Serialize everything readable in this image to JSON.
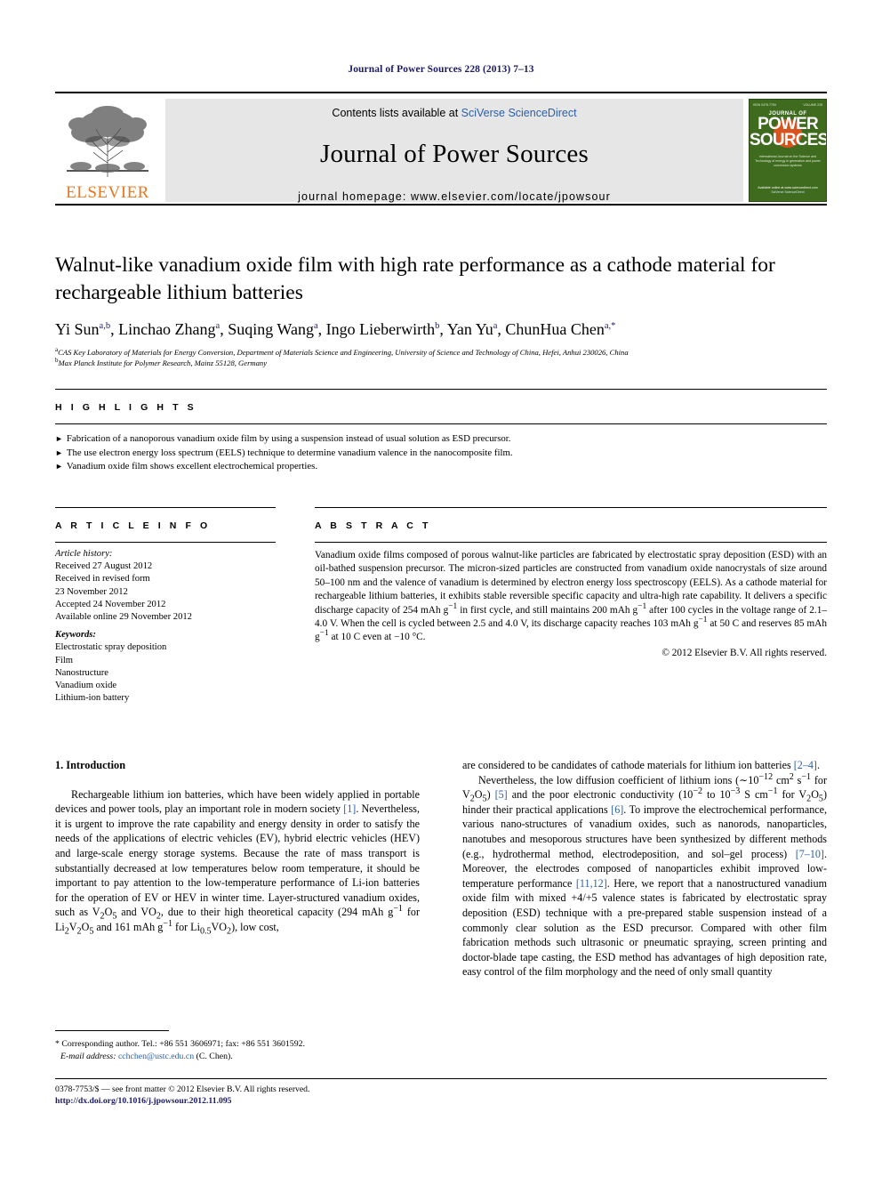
{
  "running_head": "Journal of Power Sources 228 (2013) 7–13",
  "masthead": {
    "contents_prefix": "Contents lists available at ",
    "contents_link": "SciVerse ScienceDirect",
    "journal_title": "Journal of Power Sources",
    "homepage": "journal homepage: www.elsevier.com/locate/jpowsour",
    "publisher": "ELSEVIER",
    "cover": {
      "journal_of": "JOURNAL OF",
      "power": "POWER",
      "sources": "SOURCES",
      "subtitle": "International Journal on the Science and Technology of energy in generation and power conversion systems",
      "bottom_line1": "Available online at www.sciencedirect.com",
      "bottom_line2": "SciVerse ScienceDirect",
      "corner_left": "ISSN 0378-7753",
      "corner_right": "VOLUME 228"
    }
  },
  "article": {
    "title": "Walnut-like vanadium oxide film with high rate performance as a cathode material for rechargeable lithium batteries",
    "authors": [
      {
        "name": "Yi Sun",
        "marks": "a,b"
      },
      {
        "name": "Linchao Zhang",
        "marks": "a"
      },
      {
        "name": "Suqing Wang",
        "marks": "a"
      },
      {
        "name": "Ingo Lieberwirth",
        "marks": "b"
      },
      {
        "name": "Yan Yu",
        "marks": "a"
      },
      {
        "name": "ChunHua Chen",
        "marks": "a,*"
      }
    ],
    "affiliations": [
      {
        "mark": "a",
        "text": "CAS Key Laboratory of Materials for Energy Conversion, Department of Materials Science and Engineering, University of Science and Technology of China, Hefei, Anhui 230026, China"
      },
      {
        "mark": "b",
        "text": "Max Planck Institute for Polymer Research, Mainz 55128, Germany"
      }
    ]
  },
  "highlights": {
    "heading": "H I G H L I G H T S",
    "items": [
      "Fabrication of a nanoporous vanadium oxide film by using a suspension instead of usual solution as ESD precursor.",
      "The use electron energy loss spectrum (EELS) technique to determine vanadium valence in the nanocomposite film.",
      "Vanadium oxide film shows excellent electrochemical properties."
    ]
  },
  "article_info": {
    "heading": "A R T I C L E   I N F O",
    "history_label": "Article history:",
    "history": [
      "Received 27 August 2012",
      "Received in revised form",
      "23 November 2012",
      "Accepted 24 November 2012",
      "Available online 29 November 2012"
    ],
    "keywords_label": "Keywords:",
    "keywords": [
      "Electrostatic spray deposition",
      "Film",
      "Nanostructure",
      "Vanadium oxide",
      "Lithium-ion battery"
    ]
  },
  "abstract": {
    "heading": "A B S T R A C T",
    "copyright": "© 2012 Elsevier B.V. All rights reserved."
  },
  "introduction": {
    "heading": "1. Introduction"
  },
  "footnote": {
    "corresponding": "* Corresponding author. Tel.: +86 551 3606971; fax: +86 551 3601592.",
    "email_label": "E-mail address:",
    "email": "cchchen@ustc.edu.cn",
    "email_suffix": "(C. Chen)."
  },
  "footer": {
    "issn_line": "0378-7753/$ — see front matter © 2012 Elsevier B.V. All rights reserved.",
    "doi": "http://dx.doi.org/10.1016/j.jpowsour.2012.11.095"
  }
}
